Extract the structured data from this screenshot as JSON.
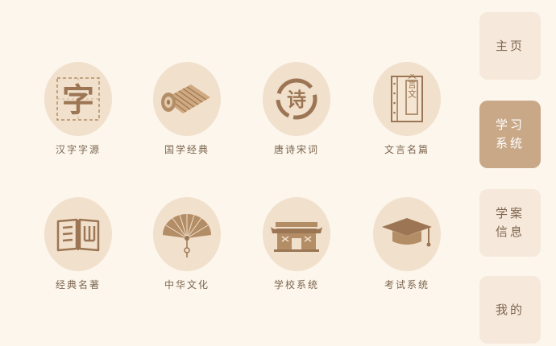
{
  "modules": [
    {
      "label": "汉字字源",
      "icon": "character-zi-icon",
      "glyph": "字"
    },
    {
      "label": "国学经典",
      "icon": "bamboo-scroll-icon"
    },
    {
      "label": "唐诗宋词",
      "icon": "poem-seal-icon",
      "glyph": "诗"
    },
    {
      "label": "文言名篇",
      "icon": "thread-bound-book-icon",
      "glyph": "文言文"
    },
    {
      "label": "经典名著",
      "icon": "open-book-icon"
    },
    {
      "label": "中华文化",
      "icon": "folding-fan-icon"
    },
    {
      "label": "学校系统",
      "icon": "school-gate-icon"
    },
    {
      "label": "考试系统",
      "icon": "graduation-cap-icon"
    }
  ],
  "sidebar": {
    "items": [
      {
        "label": "主页",
        "active": false
      },
      {
        "label": "学习系统",
        "active": true
      },
      {
        "label": "学案信息",
        "active": false
      },
      {
        "label": "我的",
        "active": false
      }
    ]
  },
  "colors": {
    "background": "#fcf6ec",
    "icon_circle": "#f1e0cc",
    "icon_ink": "#b38d66",
    "text": "#7d6650",
    "sidebar_button": "#f6e8da",
    "sidebar_active": "#c8a887"
  }
}
